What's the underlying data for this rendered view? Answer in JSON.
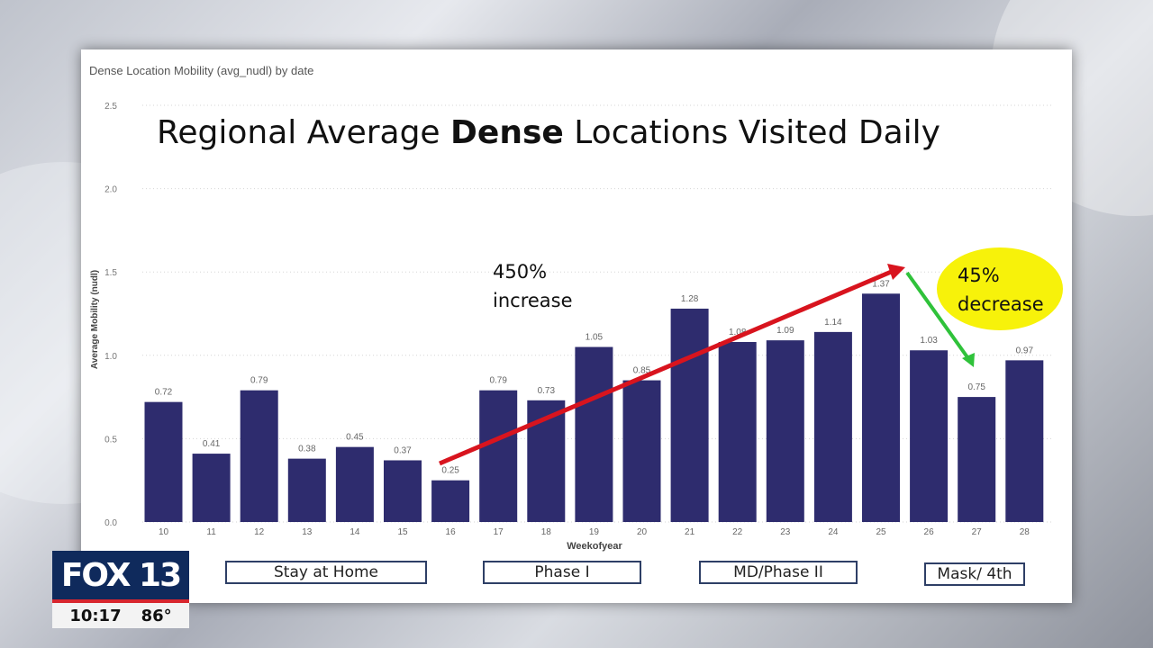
{
  "report": {
    "visual_title": "Dense Location Mobility (avg_nudl) by date",
    "slide_title_pre": "Regional Average ",
    "slide_title_bold": "Dense",
    "slide_title_post": " Locations Visited Daily"
  },
  "chart_data": {
    "type": "bar",
    "xlabel": "Weekofyear",
    "ylabel": "Average Mobility (nudl)",
    "ylim": [
      0,
      2.5
    ],
    "yticks": [
      "0.0",
      "0.5",
      "1.0",
      "1.5",
      "2.0",
      "2.5"
    ],
    "grid": true,
    "categories": [
      "10",
      "11",
      "12",
      "13",
      "14",
      "15",
      "16",
      "17",
      "18",
      "19",
      "20",
      "21",
      "22",
      "23",
      "24",
      "25",
      "26",
      "27",
      "28"
    ],
    "values": [
      0.72,
      0.41,
      0.79,
      0.38,
      0.45,
      0.37,
      0.25,
      0.79,
      0.73,
      1.05,
      0.85,
      1.28,
      1.08,
      1.09,
      1.14,
      1.37,
      1.03,
      0.75,
      0.97
    ],
    "data_labels": [
      "0.72",
      "0.41",
      "0.79",
      "0.38",
      "0.45",
      "0.37",
      "0.25",
      "0.79",
      "0.73",
      "1.05",
      "0.85",
      "1.28",
      "1.08",
      "1.09",
      "1.14",
      "1.37",
      "1.03",
      "0.75",
      "0.97"
    ],
    "bar_color": "#2e2c6e"
  },
  "annotations": {
    "increase_line1": "450%",
    "increase_line2": "increase",
    "decrease_line1": "45%",
    "decrease_line2": "decrease",
    "increase_arrow_color": "#d8141e",
    "decrease_arrow_color": "#2fc23a",
    "highlight_color": "#f7f20a"
  },
  "phases": [
    {
      "label": "Stay at Home"
    },
    {
      "label": "Phase I"
    },
    {
      "label": "MD/Phase II"
    },
    {
      "label": "Mask/ 4th"
    }
  ],
  "broadcast": {
    "logo_text": "FOX 13",
    "time": "10:17",
    "temperature": "86°"
  }
}
